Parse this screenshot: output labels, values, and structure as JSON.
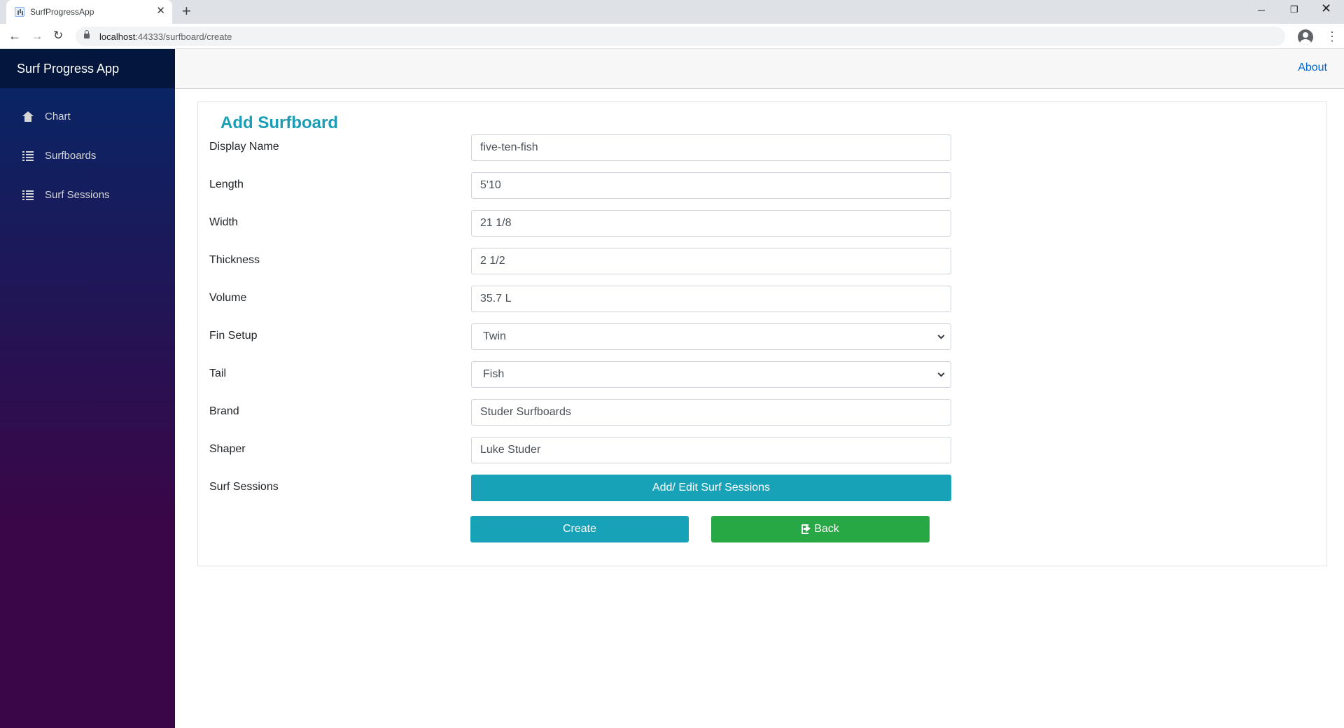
{
  "browser": {
    "tab_title": "SurfProgressApp",
    "tab_close": "✕",
    "new_tab": "+",
    "url_host": "localhost",
    "url_rest": ":44333/surfboard/create"
  },
  "sidebar": {
    "brand": "Surf Progress App",
    "items": [
      {
        "label": "Chart",
        "icon": "home-icon"
      },
      {
        "label": "Surfboards",
        "icon": "list-icon"
      },
      {
        "label": "Surf Sessions",
        "icon": "list-icon"
      }
    ]
  },
  "header": {
    "about": "About"
  },
  "form": {
    "title": "Add Surfboard",
    "display_name": {
      "label": "Display Name",
      "value": "five-ten-fish"
    },
    "length": {
      "label": "Length",
      "value": "5'10"
    },
    "width": {
      "label": "Width",
      "value": "21 1/8"
    },
    "thickness": {
      "label": "Thickness",
      "value": "2 1/2"
    },
    "volume": {
      "label": "Volume",
      "value": "35.7 L"
    },
    "fin_setup": {
      "label": "Fin Setup",
      "value": "Twin"
    },
    "tail": {
      "label": "Tail",
      "value": "Fish"
    },
    "brand": {
      "label": "Brand",
      "value": "Studer Surfboards"
    },
    "shaper": {
      "label": "Shaper",
      "value": "Luke Studer"
    },
    "surf_sessions": {
      "label": "Surf Sessions",
      "button": "Add/ Edit Surf Sessions"
    },
    "create_button": "Create",
    "back_button": "Back"
  },
  "colors": {
    "accent": "#17a2b8",
    "title": "#1b9eb5",
    "success": "#28a745",
    "link": "#0366d6",
    "sidebar_top": "#052767",
    "sidebar_bottom": "#3a0647"
  }
}
